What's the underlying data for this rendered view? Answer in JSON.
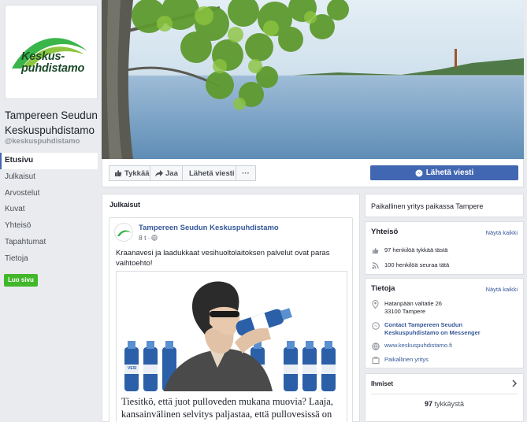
{
  "page": {
    "logo_text_line1": "Keskus-",
    "logo_text_line2": "puhdistamo",
    "name_line1": "Tampereen Seudun",
    "name_line2": "Keskuspuhdistamo",
    "handle": "@keskuspuhdistamo"
  },
  "nav": {
    "items": [
      "Etusivu",
      "Julkaisut",
      "Arvostelut",
      "Kuvat",
      "Yhteisö",
      "Tapahtumat",
      "Tietoja"
    ],
    "active_index": 0,
    "create_page": "Luo sivu"
  },
  "actions": {
    "like": "Tykkää",
    "share": "Jaa",
    "send_message": "Lähetä viesti",
    "more": "···",
    "primary_send": "Lähetä viesti"
  },
  "posts": {
    "section_title": "Julkaisut",
    "post": {
      "author": "Tampereen Seudun Keskuspuhdistamo",
      "time": "8 t",
      "text": "Kraanavesi ja laadukkaat vesihuoltolaitoksen palvelut ovat paras vaihtoehto!",
      "bottle_label": "VESI",
      "headline": "Tiesitkö, että juot pulloveden mukana muovia? Laaja, kansainvälinen selvitys paljastaa, että pullovesissä on"
    }
  },
  "sidebar": {
    "local_business": "Paikallinen yritys paikassa Tampere",
    "community": {
      "title": "Yhteisö",
      "see_all": "Näytä kaikki",
      "likes": "97 henkilöä tykkää tästä",
      "follows": "100 henkilöä seuraa tätä"
    },
    "about": {
      "title": "Tietoja",
      "see_all": "Näytä kaikki",
      "address_line1": "Hatanpään valtatie 26",
      "address_line2": "33100 Tampere",
      "messenger_line1": "Contact Tampereen Seudun",
      "messenger_line2": "Keskuspuhdistamo on Messenger",
      "website": "www.keskuspuhdistamo.fi",
      "category": "Paikallinen yritys"
    },
    "people": {
      "title": "Ihmiset",
      "likes_count": "97",
      "likes_label": "tykkäystä"
    }
  },
  "colors": {
    "brand_blue": "#4267b2",
    "link_blue": "#365899",
    "create_green": "#42b72a",
    "logo_green": "#39b54a"
  }
}
